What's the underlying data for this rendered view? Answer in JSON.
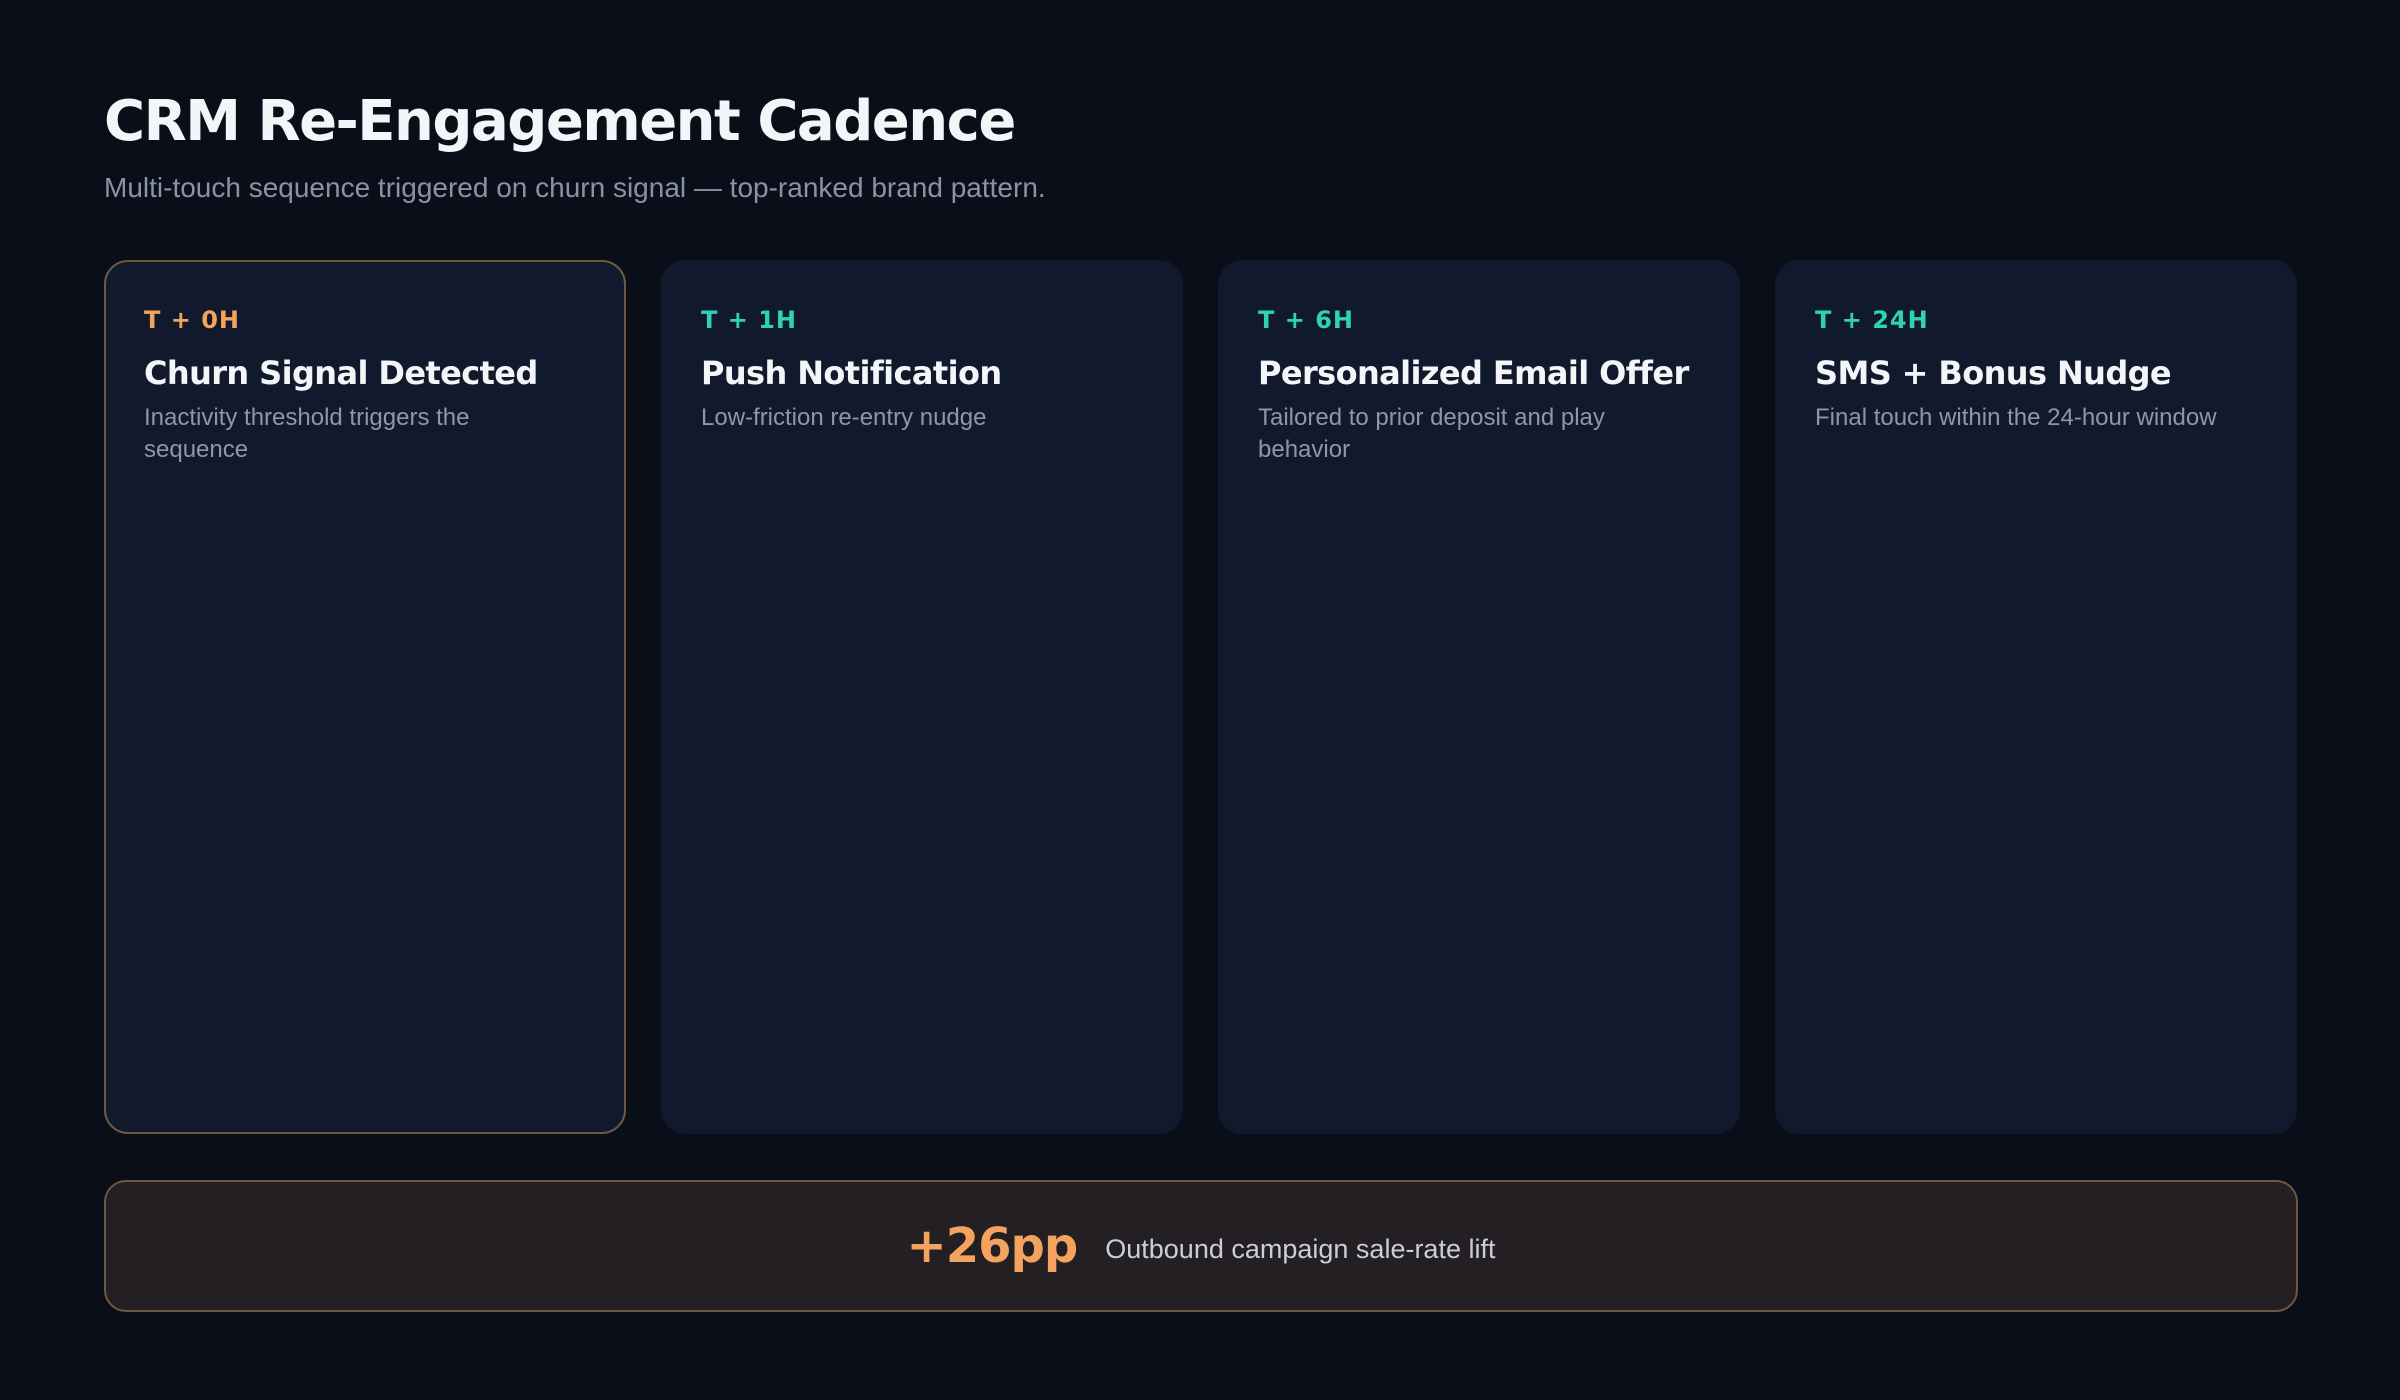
{
  "header": {
    "title": "CRM Re-Engagement Cadence",
    "subtitle": "Multi-touch sequence triggered on churn signal — top-ranked brand pattern."
  },
  "steps": [
    {
      "time": "T + 0H",
      "title": "Churn Signal Detected",
      "description": "Inactivity threshold triggers the sequence",
      "highlighted": true
    },
    {
      "time": "T + 1H",
      "title": "Push Notification",
      "description": "Low-friction re-entry nudge",
      "highlighted": false
    },
    {
      "time": "T + 6H",
      "title": "Personalized Email Offer",
      "description": "Tailored to prior deposit and play behavior",
      "highlighted": false
    },
    {
      "time": "T + 24H",
      "title": "SMS + Bonus Nudge",
      "description": "Final touch within the 24-hour window",
      "highlighted": false
    }
  ],
  "result": {
    "value": "+26pp",
    "label": "Outbound campaign sale-rate lift"
  },
  "colors": {
    "background": "#0a0e19",
    "card": "#111a2c",
    "accent_orange": "#f4a35f",
    "accent_teal": "#2ed3b7",
    "highlight_border": "#6e5840",
    "banner_background": "#231f23"
  }
}
